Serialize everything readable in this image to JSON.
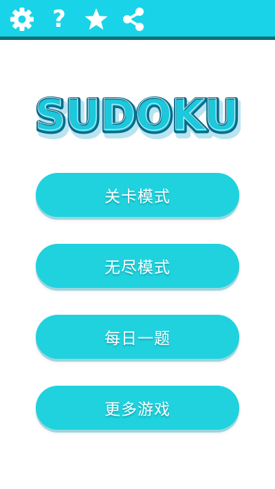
{
  "toolbar": {
    "icons": [
      "gear-icon",
      "help-icon",
      "star-icon",
      "share-icon"
    ],
    "help_label": "?"
  },
  "logo": {
    "text": "SUDOKU",
    "colors": {
      "fill": "#1cc8dc",
      "outline": "#0b6b8a",
      "highlight": "#ffffff",
      "shadow": "#b8e4f0"
    }
  },
  "menu": {
    "items": [
      {
        "label": "关卡模式"
      },
      {
        "label": "无尽模式"
      },
      {
        "label": "每日一题"
      },
      {
        "label": "更多游戏"
      }
    ]
  },
  "colors": {
    "accent": "#19d4e8",
    "accent_dark": "#0b6f7a",
    "button": "#1fd2de",
    "background": "#ffffff"
  }
}
